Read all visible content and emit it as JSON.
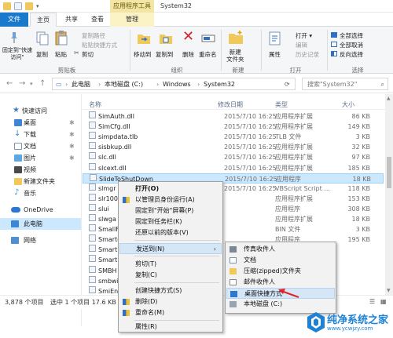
{
  "window": {
    "title": "System32",
    "context_group": "应用程序工具"
  },
  "tabs": [
    "文件",
    "主页",
    "共享",
    "查看",
    "管理"
  ],
  "ribbon": {
    "pin_quick_access": "固定到\"快速访问\"",
    "copy": "复制",
    "paste": "粘贴",
    "copy_path": "复制路径",
    "paste_shortcut": "粘贴快捷方式",
    "cut": "剪切",
    "move_to": "移动到",
    "copy_to": "复制到",
    "delete": "删除",
    "rename": "重命名",
    "new_folder": "新建\n文件夹",
    "properties": "属性",
    "open": "打开 ▾",
    "edit": "编辑",
    "history": "历史记录",
    "select_all": "全部选择",
    "select_none": "全部取消",
    "invert_selection": "反向选择",
    "groups": {
      "clipboard": "剪贴板",
      "organize": "组织",
      "new": "新建",
      "open": "打开",
      "select": "选择"
    }
  },
  "address": {
    "parts": [
      "此电脑",
      "本地磁盘 (C:)",
      "Windows",
      "System32"
    ],
    "search_placeholder": "搜索\"System32\""
  },
  "nav": {
    "quick_access": "快速访问",
    "items": [
      "桌面",
      "下载",
      "文档",
      "图片",
      "视频",
      "新建文件夹",
      "音乐"
    ],
    "onedrive": "OneDrive",
    "this_pc": "此电脑",
    "network": "网络"
  },
  "columns": {
    "name": "名称",
    "date": "修改日期",
    "type": "类型",
    "size": "大小"
  },
  "files": [
    {
      "name": "SimAuth.dll",
      "date": "2015/7/10 16:25",
      "type": "应用程序扩展",
      "size": "86 KB"
    },
    {
      "name": "SimCfg.dll",
      "date": "2015/7/10 16:25",
      "type": "应用程序扩展",
      "size": "149 KB"
    },
    {
      "name": "simpdata.tlb",
      "date": "2015/7/10 16:25",
      "type": "TLB 文件",
      "size": "3 KB"
    },
    {
      "name": "sisbkup.dll",
      "date": "2015/7/10 16:25",
      "type": "应用程序扩展",
      "size": "32 KB"
    },
    {
      "name": "slc.dll",
      "date": "2015/7/10 16:25",
      "type": "应用程序扩展",
      "size": "97 KB"
    },
    {
      "name": "slcext.dll",
      "date": "2015/7/10 16:25",
      "type": "应用程序扩展",
      "size": "185 KB"
    },
    {
      "name": "SlideToShutDown",
      "date": "2015/7/10 16:25",
      "type": "应用程序",
      "size": "18 KB"
    },
    {
      "name": "slmgr",
      "date": "2015/7/10 16:25",
      "type": "VBScript Script ...",
      "size": "118 KB"
    },
    {
      "name": "slr100",
      "date": "",
      "type": "应用程序扩展",
      "size": "153 KB"
    },
    {
      "name": "slui",
      "date": "",
      "type": "应用程序",
      "size": "308 KB"
    },
    {
      "name": "slwga",
      "date": "",
      "type": "应用程序扩展",
      "size": "18 KB"
    },
    {
      "name": "SmallF",
      "date": "",
      "type": "BIN 文件",
      "size": "3 KB"
    },
    {
      "name": "Smartc",
      "date": "",
      "type": "应用程序",
      "size": "195 KB"
    },
    {
      "name": "Smart",
      "date": "",
      "type": "",
      "size": ""
    },
    {
      "name": "Smart",
      "date": "",
      "type": "",
      "size": ""
    },
    {
      "name": "SMBH",
      "date": "",
      "type": "",
      "size": ""
    },
    {
      "name": "smbwi",
      "date": "",
      "type": "",
      "size": ""
    },
    {
      "name": "SmiEn",
      "date": "",
      "type": "",
      "size": ""
    }
  ],
  "status": {
    "items": "3,878 个项目",
    "selected": "选中 1 个项目 17.6 KB"
  },
  "context_menu": {
    "items": [
      "打开(O)",
      "以管理员身份运行(A)",
      "固定到\"开始\"屏幕(P)",
      "固定到任务栏(K)",
      "还原以前的版本(V)",
      "发送到(N)",
      "剪切(T)",
      "复制(C)",
      "创建快捷方式(S)",
      "删除(D)",
      "重命名(M)",
      "属性(R)"
    ]
  },
  "send_to": {
    "items": [
      "传真收件人",
      "文档",
      "压缩(zipped)文件夹",
      "邮件收件人",
      "桌面快捷方式",
      "本地磁盘 (C:)"
    ]
  },
  "watermark": {
    "name": "纯净系统之家",
    "url": "www.ycwjzy.com"
  }
}
